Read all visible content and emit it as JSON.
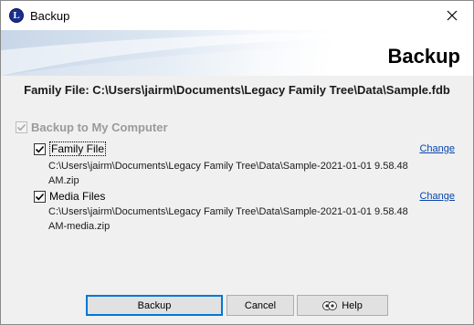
{
  "window": {
    "title": "Backup"
  },
  "header": {
    "title": "Backup"
  },
  "family_file": {
    "text": "Family File: C:\\Users\\jairm\\Documents\\Legacy Family Tree\\Data\\Sample.fdb"
  },
  "backup_group": {
    "label": "Backup to My Computer",
    "checked": true,
    "disabled": true
  },
  "items": [
    {
      "label": "Family File",
      "checked": true,
      "path_line1": "C:\\Users\\jairm\\Documents\\Legacy Family Tree\\Data\\Sample-2021-01-01 9.58.48",
      "path_line2": "AM.zip",
      "change_label": "Change"
    },
    {
      "label": "Media Files",
      "checked": true,
      "path_line1": "C:\\Users\\jairm\\Documents\\Legacy Family Tree\\Data\\Sample-2021-01-01 9.58.48",
      "path_line2": "AM-media.zip",
      "change_label": "Change"
    }
  ],
  "buttons": {
    "backup": {
      "label": "Backup"
    },
    "cancel": {
      "label": "Cancel"
    },
    "help": {
      "label": "Help"
    }
  },
  "icons": {
    "app": "legacy-l-icon",
    "close": "close-icon",
    "help": "help-icon",
    "check": "checkmark-icon"
  },
  "colors": {
    "accent": "#0078d7",
    "link": "#0645ad",
    "disabled_text": "#9a9a9a"
  }
}
